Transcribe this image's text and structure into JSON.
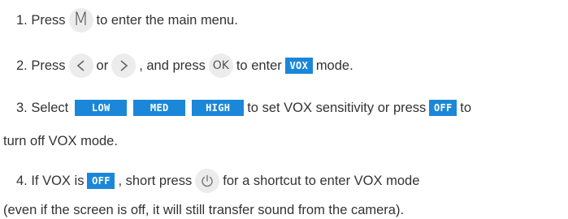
{
  "steps": {
    "s1": {
      "prefix": "1. Press",
      "key_label": "M",
      "suffix": "to enter the main menu."
    },
    "s2": {
      "prefix": "2. Press",
      "or_text": "or",
      "mid": ", and press",
      "ok_label": "OK",
      "mid2": "to enter",
      "vox_label": "VOX",
      "suffix": "mode."
    },
    "s3": {
      "prefix": "3. Select",
      "low_label": "LOW",
      "med_label": "MED",
      "high_label": "HIGH",
      "mid": "to set VOX sensitivity or press",
      "off_label": "OFF",
      "end": "to",
      "line2": "turn off VOX mode."
    },
    "s4": {
      "prefix": "4. If VOX is",
      "off_label": "OFF",
      "mid": ", short press",
      "suffix": "for a shortcut to enter VOX mode",
      "line2": "(even if the screen is off, it will still transfer sound from the camera)."
    }
  },
  "icons": {
    "left": "chevron-left-icon",
    "right": "chevron-right-icon",
    "power": "power-icon"
  },
  "colors": {
    "badge_bg": "#1b87d8",
    "key_bg": "#ececec",
    "text": "#333333"
  }
}
